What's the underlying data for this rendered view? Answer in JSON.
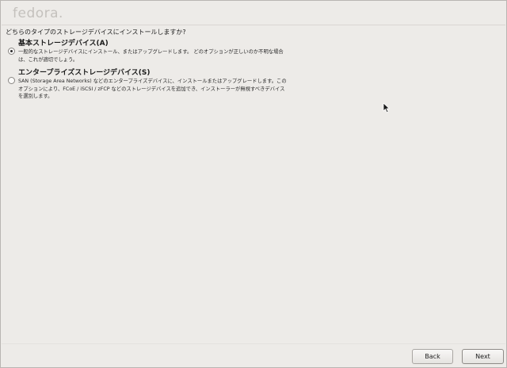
{
  "header": {
    "logo_text": "fedora",
    "logo_dot": "."
  },
  "question": "どちらのタイプのストレージデバイスにインストールしますか?",
  "options": [
    {
      "title": "基本ストレージデバイス(A)",
      "description_line1": "一般的なストレージデバイスにインストール、またはアップグレードします。 どのオプションが正しいのか不明な場合",
      "description_line2": "は、これが適切でしょう。",
      "selected": true
    },
    {
      "title": "エンタープライズストレージデバイス(S)",
      "description_line1": "SAN (Storage Area Networks) などのエンタープライズデバイスに、インストールまたはアップグレードします。この",
      "description_line2": "オプションにより、FCoE / iSCSI / zFCP などのストレージデバイスを追加でき、インストーラーが無視すべきデバイス",
      "description_line3": "を選別します。",
      "selected": false
    }
  ],
  "footer": {
    "back_label": "Back",
    "next_label": "Next"
  },
  "icons": {
    "cursor": "mouse-pointer-icon"
  }
}
